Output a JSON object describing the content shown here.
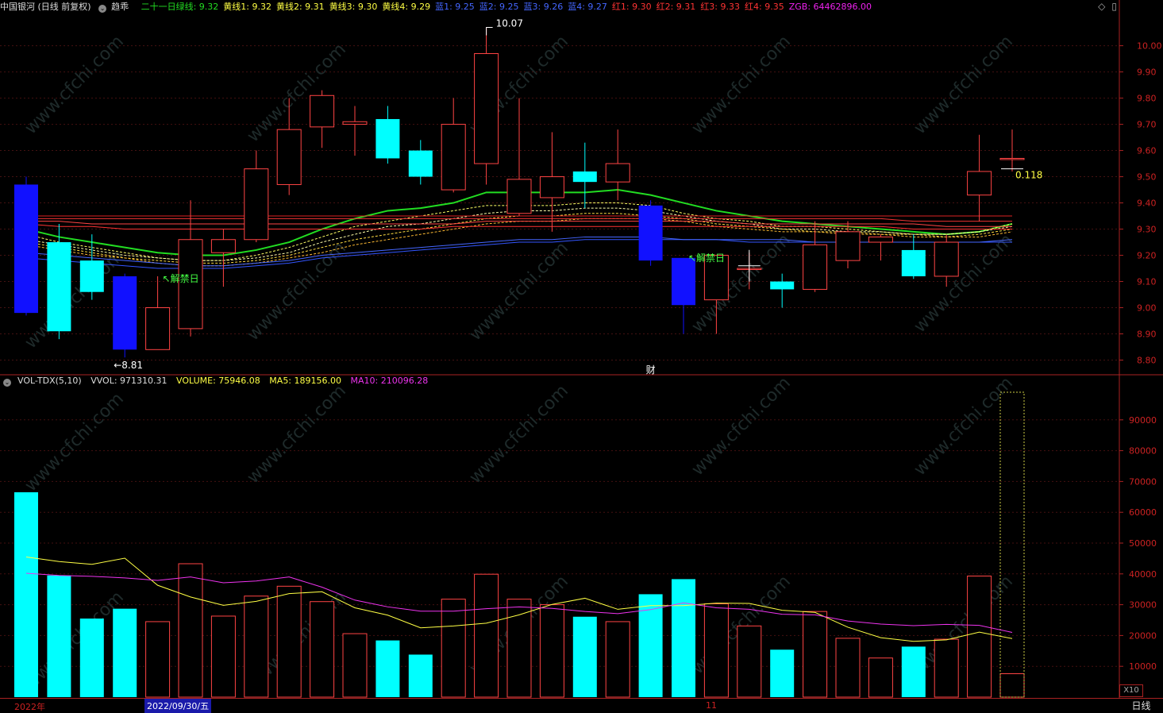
{
  "header": {
    "title": "中国银河 (日线 前复权)",
    "indicator": "趋乖",
    "items": [
      {
        "label": "二十一日绿线: 9.32",
        "color": "#22dd22"
      },
      {
        "label": "黄线1: 9.32",
        "color": "#ffff44"
      },
      {
        "label": "黄线2: 9.31",
        "color": "#ffff44"
      },
      {
        "label": "黄线3: 9.30",
        "color": "#ffff44"
      },
      {
        "label": "黄线4: 9.29",
        "color": "#ffff44"
      },
      {
        "label": "蓝1: 9.25",
        "color": "#4466ff"
      },
      {
        "label": "蓝2: 9.25",
        "color": "#4466ff"
      },
      {
        "label": "蓝3: 9.26",
        "color": "#4466ff"
      },
      {
        "label": "蓝4: 9.27",
        "color": "#4466ff"
      },
      {
        "label": "红1: 9.30",
        "color": "#ff3333"
      },
      {
        "label": "红2: 9.31",
        "color": "#ff3333"
      },
      {
        "label": "红3: 9.33",
        "color": "#ff3333"
      },
      {
        "label": "红4: 9.35",
        "color": "#ff3333"
      },
      {
        "label": "ZGB: 64462896.00",
        "color": "#ee22ee"
      }
    ],
    "icons": [
      "diamond-icon",
      "window-icon"
    ]
  },
  "volume_header": {
    "name": "VOL-TDX(5,10)",
    "vvol": "VVOL: 971310.31",
    "volume": "VOLUME: 75946.08",
    "ma5": "MA5: 189156.00",
    "ma10": "MA10: 210096.28"
  },
  "footer": {
    "year": "2022年",
    "cursor_date": "2022/09/30/五",
    "month": "11",
    "period": "日线",
    "scale": "X10"
  },
  "chart_data": [
    {
      "type": "candlestick",
      "price_axis": {
        "ylim": [
          8.75,
          10.12
        ],
        "ticks": [
          "10.00",
          "9.90",
          "9.80",
          "9.70",
          "9.60",
          "9.50",
          "9.40",
          "9.30",
          "9.20",
          "9.10",
          "9.00",
          "8.90",
          "8.80"
        ]
      },
      "candles": [
        {
          "o": 9.47,
          "h": 9.5,
          "l": 8.97,
          "c": 8.98
        },
        {
          "o": 9.25,
          "h": 9.32,
          "l": 8.88,
          "c": 8.91
        },
        {
          "o": 9.18,
          "h": 9.28,
          "l": 9.03,
          "c": 9.06
        },
        {
          "o": 9.12,
          "h": 9.13,
          "l": 8.81,
          "c": 8.84
        },
        {
          "o": 8.84,
          "h": 9.12,
          "l": 8.84,
          "c": 9.0
        },
        {
          "o": 8.92,
          "h": 9.41,
          "l": 8.89,
          "c": 9.26
        },
        {
          "o": 9.21,
          "h": 9.3,
          "l": 9.08,
          "c": 9.26
        },
        {
          "o": 9.26,
          "h": 9.6,
          "l": 9.25,
          "c": 9.53
        },
        {
          "o": 9.47,
          "h": 9.8,
          "l": 9.43,
          "c": 9.68
        },
        {
          "o": 9.69,
          "h": 9.83,
          "l": 9.61,
          "c": 9.81
        },
        {
          "o": 9.7,
          "h": 9.77,
          "l": 9.58,
          "c": 9.71
        },
        {
          "o": 9.72,
          "h": 9.77,
          "l": 9.55,
          "c": 9.57
        },
        {
          "o": 9.6,
          "h": 9.64,
          "l": 9.47,
          "c": 9.5
        },
        {
          "o": 9.45,
          "h": 9.8,
          "l": 9.44,
          "c": 9.7
        },
        {
          "o": 9.55,
          "h": 10.07,
          "l": 9.47,
          "c": 9.97
        },
        {
          "o": 9.36,
          "h": 9.8,
          "l": 9.35,
          "c": 9.49
        },
        {
          "o": 9.42,
          "h": 9.67,
          "l": 9.29,
          "c": 9.5
        },
        {
          "o": 9.52,
          "h": 9.63,
          "l": 9.38,
          "c": 9.48
        },
        {
          "o": 9.48,
          "h": 9.68,
          "l": 9.41,
          "c": 9.55
        },
        {
          "o": 9.39,
          "h": 9.41,
          "l": 9.16,
          "c": 9.18
        },
        {
          "o": 9.19,
          "h": 9.19,
          "l": 8.9,
          "c": 9.01
        },
        {
          "o": 9.03,
          "h": 9.2,
          "l": 8.9,
          "c": 9.2
        },
        {
          "o": 9.15,
          "h": 9.21,
          "l": 9.07,
          "c": 9.15
        },
        {
          "o": 9.1,
          "h": 9.13,
          "l": 9.0,
          "c": 9.07
        },
        {
          "o": 9.07,
          "h": 9.33,
          "l": 9.06,
          "c": 9.24
        },
        {
          "o": 9.18,
          "h": 9.33,
          "l": 9.15,
          "c": 9.29
        },
        {
          "o": 9.25,
          "h": 9.28,
          "l": 9.18,
          "c": 9.27
        },
        {
          "o": 9.22,
          "h": 9.28,
          "l": 9.11,
          "c": 9.12
        },
        {
          "o": 9.12,
          "h": 9.28,
          "l": 9.08,
          "c": 9.25
        },
        {
          "o": 9.43,
          "h": 9.66,
          "l": 9.33,
          "c": 9.52
        },
        {
          "o": 9.57,
          "h": 9.68,
          "l": 9.52,
          "c": 9.57
        }
      ],
      "annotations": [
        {
          "candle": 14,
          "price": 10.07,
          "text": "10.07",
          "color": "#ffffff"
        },
        {
          "candle": 3,
          "price": 8.81,
          "text": "←8.81",
          "color": "#ffffff"
        },
        {
          "candle": 4,
          "price": 9.11,
          "text": "↖解禁日",
          "color": "#44ff44"
        },
        {
          "candle": 20,
          "price": 9.19,
          "text": "↖解禁日",
          "color": "#44ff44"
        },
        {
          "candle": 19,
          "price": 8.78,
          "text": "财",
          "color": "#ffffff"
        },
        {
          "candle": 30,
          "price": 9.53,
          "text": "0.118",
          "color": "#ffff44"
        }
      ],
      "lines": [
        {
          "name": "二十一日绿线",
          "color": "#22dd22",
          "width": 2,
          "values": [
            9.3,
            9.27,
            9.25,
            9.23,
            9.21,
            9.2,
            9.2,
            9.22,
            9.25,
            9.3,
            9.34,
            9.37,
            9.38,
            9.4,
            9.44,
            9.44,
            9.44,
            9.44,
            9.45,
            9.43,
            9.4,
            9.37,
            9.35,
            9.33,
            9.32,
            9.31,
            9.3,
            9.29,
            9.28,
            9.29,
            9.32
          ]
        },
        {
          "name": "黄线1",
          "color": "#ffff66",
          "width": 1,
          "values": [
            9.28,
            9.25,
            9.23,
            9.21,
            9.19,
            9.18,
            9.18,
            9.2,
            9.23,
            9.27,
            9.31,
            9.33,
            9.35,
            9.37,
            9.39,
            9.39,
            9.39,
            9.4,
            9.4,
            9.39,
            9.36,
            9.34,
            9.33,
            9.31,
            9.31,
            9.3,
            9.29,
            9.28,
            9.28,
            9.29,
            9.32
          ]
        },
        {
          "name": "黄线2",
          "color": "#ffffaa",
          "width": 1,
          "values": [
            9.26,
            9.24,
            9.22,
            9.2,
            9.19,
            9.18,
            9.18,
            9.19,
            9.21,
            9.25,
            9.28,
            9.31,
            9.32,
            9.34,
            9.36,
            9.37,
            9.37,
            9.38,
            9.38,
            9.37,
            9.35,
            9.33,
            9.32,
            9.3,
            9.3,
            9.29,
            9.29,
            9.28,
            9.28,
            9.29,
            9.31
          ]
        },
        {
          "name": "黄线3",
          "color": "#ffdd44",
          "width": 1,
          "values": [
            9.25,
            9.23,
            9.21,
            9.19,
            9.18,
            9.17,
            9.17,
            9.18,
            9.2,
            9.23,
            9.26,
            9.28,
            9.3,
            9.32,
            9.34,
            9.35,
            9.35,
            9.36,
            9.36,
            9.35,
            9.34,
            9.32,
            9.31,
            9.3,
            9.29,
            9.29,
            9.28,
            9.28,
            9.27,
            9.28,
            9.3
          ]
        },
        {
          "name": "黄线4",
          "color": "#ffbb33",
          "width": 1,
          "values": [
            9.24,
            9.22,
            9.2,
            9.19,
            9.17,
            9.16,
            9.16,
            9.17,
            9.19,
            9.21,
            9.24,
            9.26,
            9.28,
            9.3,
            9.32,
            9.33,
            9.33,
            9.34,
            9.34,
            9.34,
            9.33,
            9.31,
            9.3,
            9.29,
            9.29,
            9.28,
            9.28,
            9.27,
            9.27,
            9.27,
            9.29
          ]
        },
        {
          "name": "蓝1",
          "color": "#3355ff",
          "width": 1,
          "values": [
            9.19,
            9.18,
            9.17,
            9.16,
            9.15,
            9.15,
            9.15,
            9.16,
            9.17,
            9.19,
            9.2,
            9.21,
            9.22,
            9.23,
            9.24,
            9.25,
            9.25,
            9.26,
            9.26,
            9.26,
            9.26,
            9.26,
            9.25,
            9.25,
            9.25,
            9.25,
            9.25,
            9.25,
            9.25,
            9.25,
            9.25
          ]
        },
        {
          "name": "蓝2",
          "color": "#4466ff",
          "width": 1,
          "values": [
            9.21,
            9.2,
            9.19,
            9.18,
            9.17,
            9.16,
            9.16,
            9.17,
            9.18,
            9.2,
            9.21,
            9.22,
            9.23,
            9.24,
            9.25,
            9.26,
            9.26,
            9.27,
            9.27,
            9.27,
            9.26,
            9.26,
            9.26,
            9.26,
            9.25,
            9.25,
            9.25,
            9.25,
            9.25,
            9.25,
            9.26
          ]
        },
        {
          "name": "红1",
          "color": "#ff3333",
          "width": 1,
          "values": [
            9.32,
            9.31,
            9.31,
            9.3,
            9.3,
            9.3,
            9.3,
            9.3,
            9.3,
            9.3,
            9.3,
            9.3,
            9.3,
            9.31,
            9.31,
            9.31,
            9.31,
            9.31,
            9.31,
            9.31,
            9.31,
            9.31,
            9.31,
            9.31,
            9.31,
            9.31,
            9.31,
            9.3,
            9.3,
            9.3,
            9.3
          ]
        },
        {
          "name": "红2",
          "color": "#ff4444",
          "width": 1,
          "values": [
            9.33,
            9.33,
            9.32,
            9.32,
            9.32,
            9.32,
            9.32,
            9.32,
            9.32,
            9.32,
            9.32,
            9.32,
            9.32,
            9.32,
            9.33,
            9.33,
            9.33,
            9.33,
            9.33,
            9.33,
            9.33,
            9.33,
            9.32,
            9.32,
            9.32,
            9.32,
            9.32,
            9.32,
            9.31,
            9.31,
            9.31
          ]
        },
        {
          "name": "红3",
          "color": "#ee3333",
          "width": 1,
          "values": [
            9.34,
            9.34,
            9.34,
            9.34,
            9.34,
            9.34,
            9.34,
            9.34,
            9.34,
            9.34,
            9.34,
            9.34,
            9.34,
            9.34,
            9.34,
            9.34,
            9.34,
            9.34,
            9.34,
            9.34,
            9.34,
            9.34,
            9.34,
            9.34,
            9.34,
            9.34,
            9.34,
            9.33,
            9.33,
            9.33,
            9.33
          ]
        },
        {
          "name": "红4",
          "color": "#dd2222",
          "width": 1,
          "values": [
            9.35,
            9.35,
            9.35,
            9.35,
            9.35,
            9.35,
            9.35,
            9.35,
            9.35,
            9.35,
            9.35,
            9.35,
            9.35,
            9.35,
            9.35,
            9.35,
            9.35,
            9.35,
            9.35,
            9.35,
            9.35,
            9.35,
            9.35,
            9.35,
            9.35,
            9.35,
            9.35,
            9.35,
            9.35,
            9.35,
            9.35
          ]
        }
      ]
    },
    {
      "type": "bar",
      "ylim": [
        0,
        100000
      ],
      "ticks": [
        "90000",
        "80000",
        "70000",
        "60000",
        "50000",
        "40000",
        "30000",
        "20000",
        "10000"
      ],
      "volumes": [
        66500,
        39500,
        25500,
        28700,
        24500,
        43300,
        26300,
        32800,
        36000,
        31000,
        20600,
        18400,
        13800,
        31800,
        39900,
        31800,
        30000,
        26100,
        24500,
        33400,
        38300,
        30300,
        23100,
        15400,
        27800,
        19100,
        12700,
        16400,
        18800,
        39300,
        7600
      ],
      "ma5": [
        45500,
        44000,
        43100,
        45100,
        36300,
        32500,
        29800,
        31100,
        33600,
        34200,
        29000,
        26600,
        22500,
        23100,
        24000,
        26700,
        30100,
        32100,
        28500,
        29700,
        29700,
        30500,
        30400,
        28200,
        27500,
        22700,
        19300,
        18100,
        18600,
        21100,
        19000
      ],
      "ma10": [
        40200,
        39500,
        39200,
        38700,
        37900,
        39000,
        37100,
        37700,
        39000,
        35700,
        31500,
        29300,
        27900,
        27900,
        28700,
        29300,
        28800,
        27800,
        27100,
        28400,
        30600,
        29000,
        28500,
        26900,
        26700,
        24700,
        23700,
        23200,
        23600,
        23300,
        21000
      ],
      "ma5_color": "#ffff44",
      "ma10_color": "#ee33ee",
      "bar_up_color": "#ff4444",
      "bar_down_color": "#00ffff",
      "highlight_index": 30
    }
  ],
  "colors": {
    "up": "#ff4444",
    "down_cyan": "#00ffff",
    "down_blue": "#1111ff",
    "axis": "#aa2222",
    "axis_text": "#cc2222",
    "watermark": "#1e2a2a"
  },
  "watermark_text": "www.cfchi.com"
}
